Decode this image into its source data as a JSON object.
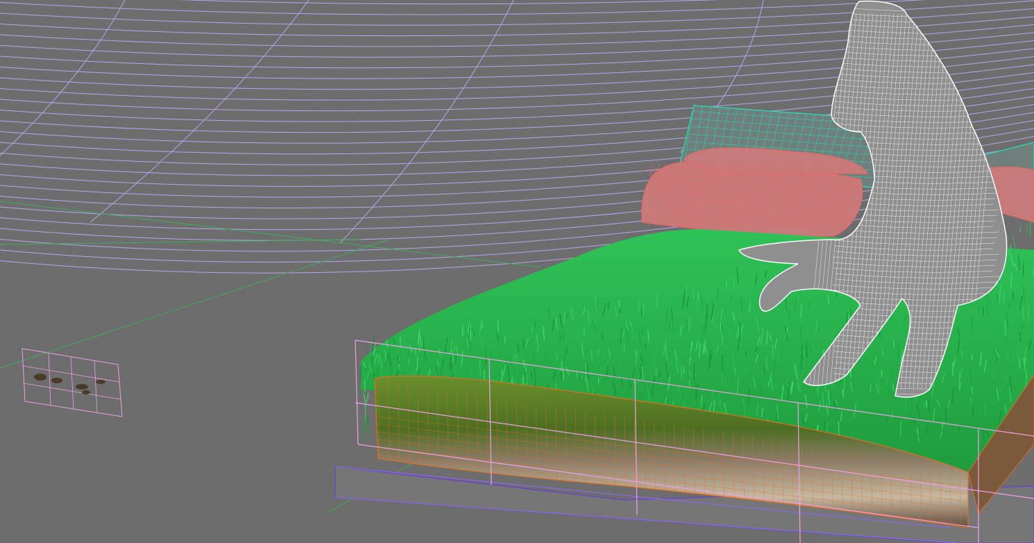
{
  "viewport": {
    "background_color": "#6d6d6d",
    "grid_color": "#b9a6f0",
    "horizon_line_color": "#3fae5a",
    "objects": [
      {
        "name": "horse",
        "render_mode": "wireframe",
        "wire_color": "#ffffff"
      },
      {
        "name": "pillows",
        "render_mode": "wireframe",
        "wire_color": "#e26a6a"
      },
      {
        "name": "headboard",
        "render_mode": "wireframe",
        "wire_color": "#2fd3b0"
      },
      {
        "name": "grass",
        "render_mode": "shaded",
        "color": "#2fb84a"
      },
      {
        "name": "soil-block",
        "render_mode": "textured",
        "wire_color": "#e0701f"
      },
      {
        "name": "bed-base",
        "render_mode": "wireframe",
        "wire_color": "#6a3dd6"
      },
      {
        "name": "selection-box",
        "render_mode": "bounding-box",
        "wire_color": "#f0a0e6"
      },
      {
        "name": "small-image-plane",
        "render_mode": "bounding-box",
        "wire_color": "#f0a0e6"
      }
    ]
  }
}
